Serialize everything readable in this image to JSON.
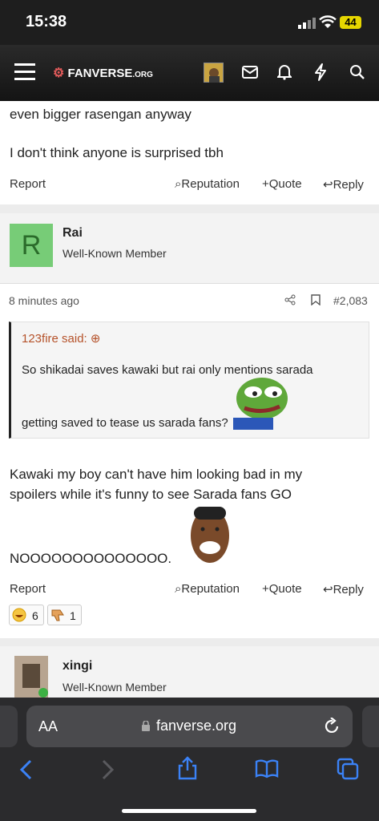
{
  "status_bar": {
    "time": "15:38",
    "battery": "44"
  },
  "header": {
    "logo_text": "FANVERSE",
    "logo_suffix": ".ORG"
  },
  "post_prev": {
    "line_cut": "even bigger rasengan anyway",
    "line2": "I don't think anyone is surprised tbh",
    "report": "Report",
    "reputation": "Reputation",
    "quote": "Quote",
    "reply": "Reply"
  },
  "post_main": {
    "avatar_letter": "R",
    "avatar_color": "#77cc77",
    "username": "Rai",
    "user_title": "Well-Known Member",
    "time": "8 minutes ago",
    "post_number": "#2,083",
    "quote": {
      "author": "123fire said:",
      "line1": "So shikadai saves kawaki but rai only mentions sarada",
      "line2": "getting saved to tease us sarada fans?"
    },
    "body_line1": "Kawaki my boy can't have him looking bad in my",
    "body_line2": "spoilers while it's funny to see Sarada fans GO",
    "body_line3": "NOOOOOOOOOOOOOO.",
    "report": "Report",
    "reputation": "Reputation",
    "quote_btn": "Quote",
    "reply": "Reply",
    "reactions": [
      {
        "count": "6"
      },
      {
        "count": "1"
      }
    ]
  },
  "post_next": {
    "username": "xingi",
    "user_title": "Well-Known Member"
  },
  "browser": {
    "url": "fanverse.org",
    "aa": "AA"
  },
  "colors": {
    "link": "#b5522a",
    "ios_blue": "#3b82f6"
  }
}
